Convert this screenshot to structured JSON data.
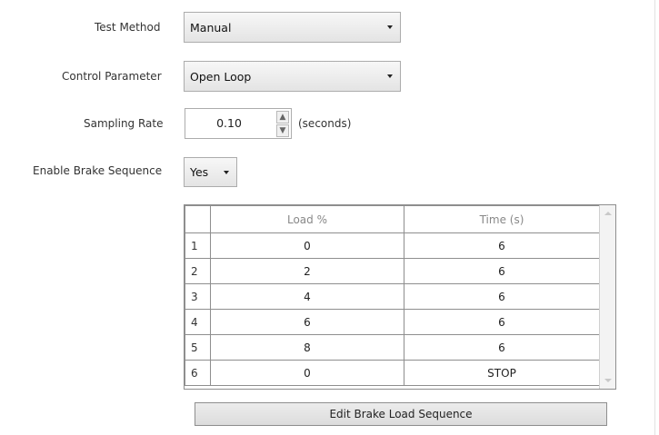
{
  "form": {
    "test_method": {
      "label": "Test Method",
      "value": "Manual"
    },
    "control_parameter": {
      "label": "Control Parameter",
      "value": "Open Loop"
    },
    "sampling_rate": {
      "label": "Sampling Rate",
      "value": "0.10",
      "units": "(seconds)"
    },
    "enable_brake_sequence": {
      "label": "Enable Brake Sequence",
      "value": "Yes"
    }
  },
  "sequence_table": {
    "columns": [
      "Load %",
      "Time (s)"
    ],
    "rows": [
      {
        "index": "1",
        "load": "0",
        "time": "6"
      },
      {
        "index": "2",
        "load": "2",
        "time": "6"
      },
      {
        "index": "3",
        "load": "4",
        "time": "6"
      },
      {
        "index": "4",
        "load": "6",
        "time": "6"
      },
      {
        "index": "5",
        "load": "8",
        "time": "6"
      },
      {
        "index": "6",
        "load": "0",
        "time": "STOP"
      }
    ]
  },
  "buttons": {
    "edit_sequence": "Edit Brake Load Sequence"
  },
  "icons": {
    "dropdown": "chevron-down-icon",
    "spin_up": "spin-up-icon",
    "spin_down": "spin-down-icon"
  }
}
